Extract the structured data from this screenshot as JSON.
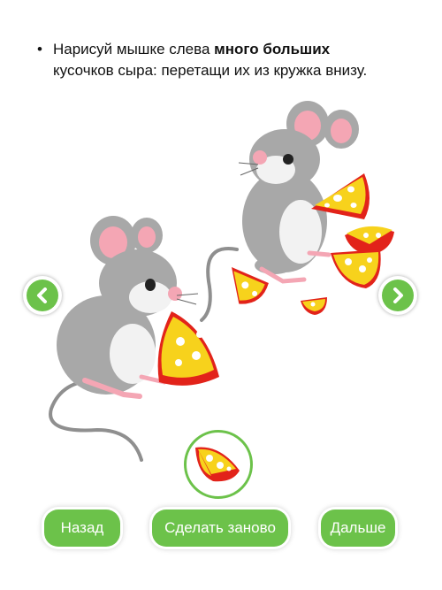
{
  "instruction": {
    "bullet": "•",
    "text_before": "Нарисуй мышке слева ",
    "text_bold": "много больших",
    "line2": "кусочков сыра: перетащи их из кружка внизу."
  },
  "buttons": {
    "back": "Назад",
    "reset": "Сделать заново",
    "next": "Дальше"
  },
  "colors": {
    "accent": "#6cc24a",
    "cheese": "#f7d21c",
    "rind": "#e2231a",
    "mouse": "#a8a8a8"
  },
  "icons": {
    "left": "chevron-left-icon",
    "right": "chevron-right-icon",
    "cheese": "cheese-icon"
  }
}
